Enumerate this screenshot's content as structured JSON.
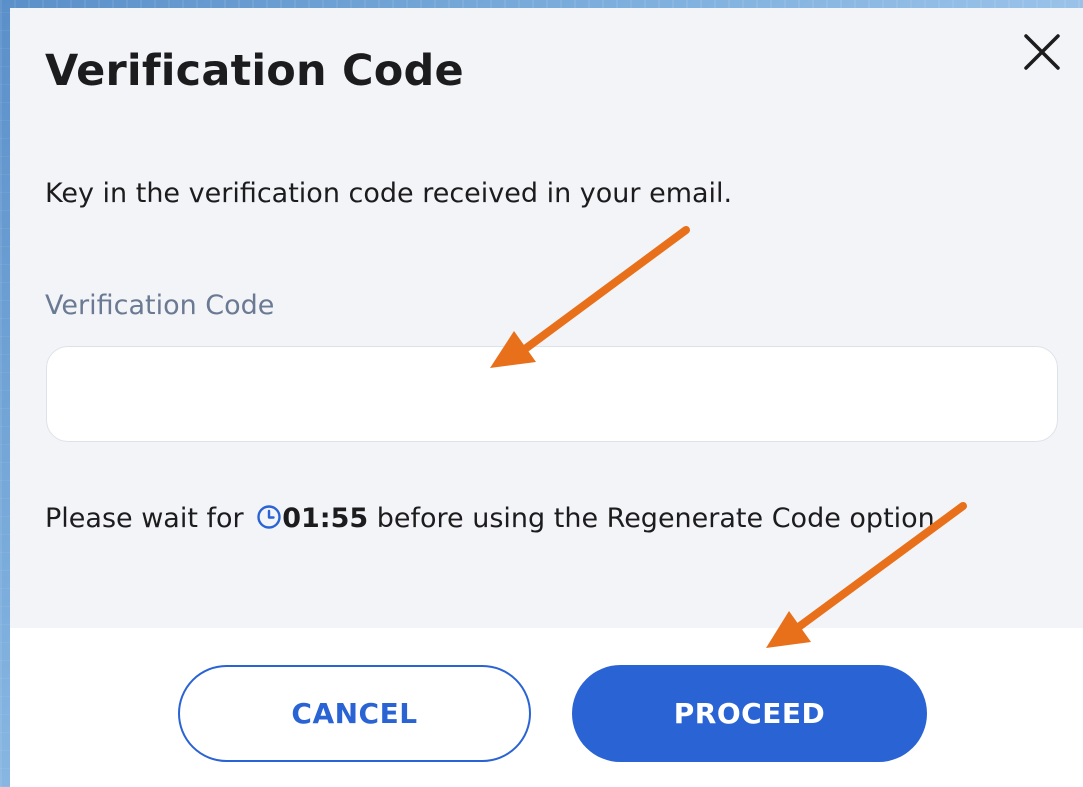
{
  "modal": {
    "title": "Verification Code",
    "close_icon": "close-icon",
    "instructions": "Key in the verification code received in your email.",
    "field_label": "Verification Code",
    "field_value": "",
    "field_placeholder": "",
    "wait_prefix": "Please wait for",
    "timer_icon": "clock-icon",
    "timer": "01:55",
    "wait_suffix": "before using the Regenerate Code option."
  },
  "footer": {
    "cancel_label": "CANCEL",
    "proceed_label": "PROCEED"
  },
  "colors": {
    "accent": "#2a63d4",
    "annotation_arrow": "#e8701a",
    "panel_bg": "#f3f4f7",
    "label_gray": "#6b7a93"
  }
}
